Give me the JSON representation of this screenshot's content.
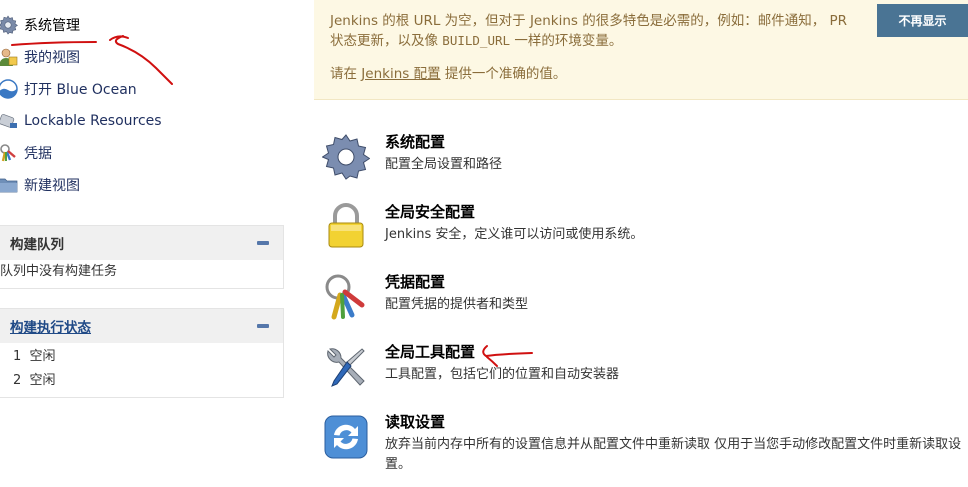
{
  "sidebar": {
    "items": [
      {
        "label": "系统管理",
        "icon": "gear-icon"
      },
      {
        "label": "我的视图",
        "icon": "user-icon"
      },
      {
        "label": "打开 Blue Ocean",
        "icon": "blue-ocean-icon"
      },
      {
        "label": "Lockable Resources",
        "icon": "lock-device-icon"
      },
      {
        "label": "凭据",
        "icon": "keys-icon"
      },
      {
        "label": "新建视图",
        "icon": "folder-icon"
      }
    ]
  },
  "build_queue": {
    "title": "构建队列",
    "empty_text": "队列中没有构建任务"
  },
  "executors": {
    "title": "构建执行状态",
    "rows": [
      {
        "num": "1",
        "status": "空闲"
      },
      {
        "num": "2",
        "status": "空闲"
      }
    ]
  },
  "notice": {
    "line1": "Jenkins 的根 URL 为空，但对于 Jenkins 的很多特色是必需的，例如：邮件通知， PR",
    "line2_pre": "状态更新，以及像 ",
    "line2_code": "BUILD_URL",
    "line2_post": " 一样的环境变量。",
    "line3_pre": "请在 ",
    "line3_link": "Jenkins 配置",
    "line3_post": " 提供一个准确的值。",
    "dismiss_label": "不再显示"
  },
  "manage": [
    {
      "title": "系统配置",
      "desc": "配置全局设置和路径",
      "icon": "gear-icon"
    },
    {
      "title": "全局安全配置",
      "desc": "Jenkins 安全，定义谁可以访问或使用系统。",
      "icon": "padlock-icon"
    },
    {
      "title": "凭据配置",
      "desc": "配置凭据的提供者和类型",
      "icon": "keys-icon"
    },
    {
      "title": "全局工具配置",
      "desc": "工具配置，包括它们的位置和自动安装器",
      "icon": "tools-icon"
    },
    {
      "title": "读取设置",
      "desc": "放弃当前内存中所有的设置信息并从配置文件中重新读取 仅用于当您手动修改配置文件时重新读取设置。",
      "icon": "reload-icon"
    }
  ]
}
